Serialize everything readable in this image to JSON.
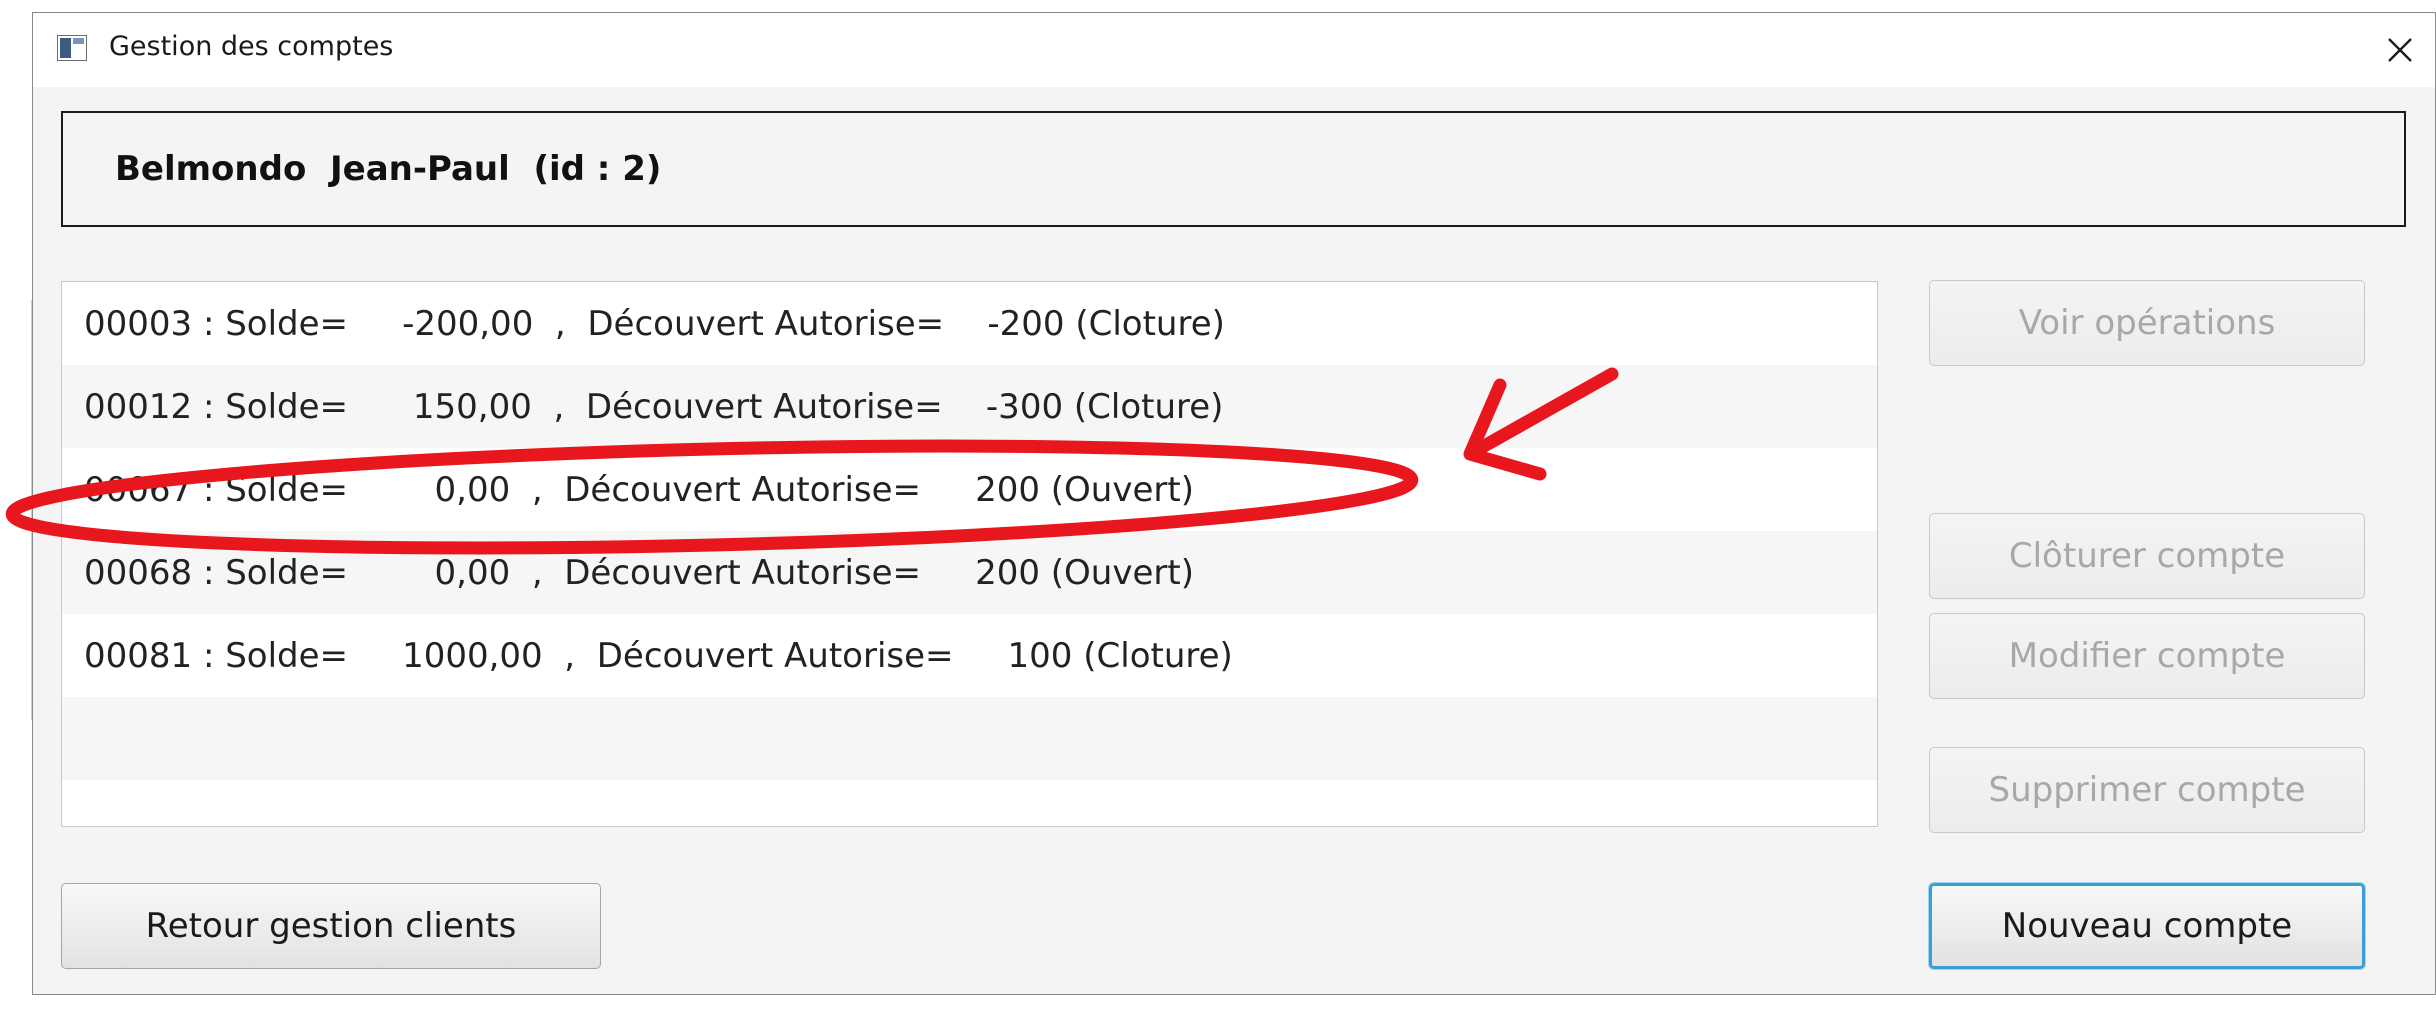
{
  "window": {
    "title": "Gestion des comptes"
  },
  "client": {
    "label": "Belmondo  Jean-Paul  (id : 2)"
  },
  "accounts": [
    {
      "text": "00003 : Solde=     -200,00  ,  Découvert Autorise=    -200 (Cloture)"
    },
    {
      "text": "00012 : Solde=      150,00  ,  Découvert Autorise=    -300 (Cloture)"
    },
    {
      "text": "00067 : Solde=        0,00  ,  Découvert Autorise=     200 (Ouvert)"
    },
    {
      "text": "00068 : Solde=        0,00  ,  Découvert Autorise=     200 (Ouvert)"
    },
    {
      "text": "00081 : Solde=     1000,00  ,  Découvert Autorise=     100 (Cloture)"
    }
  ],
  "buttons": {
    "voir_operations": "Voir opérations",
    "cloturer": "Clôturer compte",
    "modifier": "Modifier compte",
    "supprimer": "Supprimer compte",
    "retour": "Retour gestion clients",
    "nouveau": "Nouveau compte"
  },
  "colors": {
    "annotation": "#e8171d",
    "focus_border": "#3a9fd6"
  },
  "icons": {
    "app": "window-icon",
    "close": "close-icon"
  }
}
